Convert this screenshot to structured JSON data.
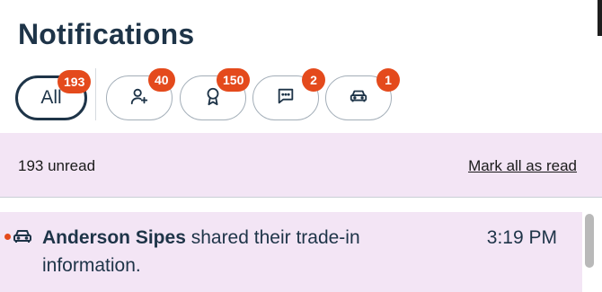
{
  "header": {
    "title": "Notifications"
  },
  "filters": [
    {
      "key": "all",
      "label": "All",
      "badge": "193",
      "icon": ""
    },
    {
      "key": "people",
      "label": "",
      "badge": "40",
      "icon": "person-add-icon"
    },
    {
      "key": "awards",
      "label": "",
      "badge": "150",
      "icon": "award-ribbon-icon"
    },
    {
      "key": "messages",
      "label": "",
      "badge": "2",
      "icon": "chat-bubble-icon"
    },
    {
      "key": "vehicles",
      "label": "",
      "badge": "1",
      "icon": "car-icon"
    }
  ],
  "summary": {
    "unread_text": "193 unread",
    "mark_all_label": "Mark all as read"
  },
  "notifications": [
    {
      "icon": "car-icon",
      "actor": "Anderson Sipes",
      "message": " shared their trade-in information.",
      "time": "3:19 PM",
      "unread": true
    }
  ],
  "colors": {
    "accent": "#e44a1c",
    "unread_bg": "#f3e5f5",
    "text_dark": "#1e3448"
  }
}
